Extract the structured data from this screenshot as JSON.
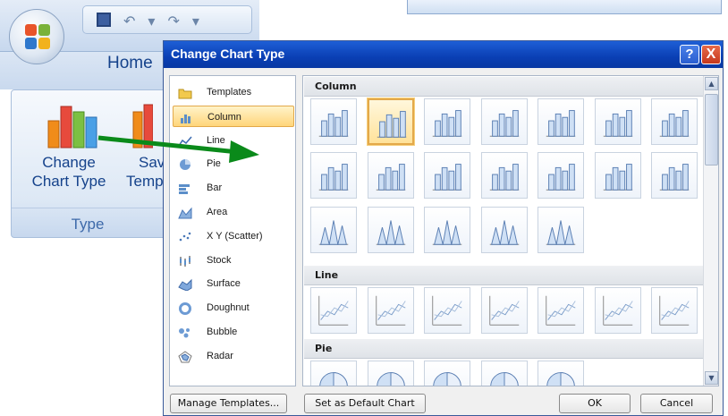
{
  "ribbon": {
    "tab_home": "Home",
    "change_chart_type_line1": "Change",
    "change_chart_type_line2": "Chart Type",
    "save_template_line1": "Save",
    "save_template_line2": "Temp",
    "group_label": "Type"
  },
  "dialog": {
    "title": "Change Chart Type",
    "help_label": "?",
    "close_label": "X",
    "categories": [
      {
        "label": "Templates",
        "icon": "folder-icon"
      },
      {
        "label": "Column",
        "icon": "column-chart-icon",
        "selected": true
      },
      {
        "label": "Line",
        "icon": "line-chart-icon"
      },
      {
        "label": "Pie",
        "icon": "pie-chart-icon"
      },
      {
        "label": "Bar",
        "icon": "bar-chart-icon"
      },
      {
        "label": "Area",
        "icon": "area-chart-icon"
      },
      {
        "label": "X Y (Scatter)",
        "icon": "scatter-chart-icon"
      },
      {
        "label": "Stock",
        "icon": "stock-chart-icon"
      },
      {
        "label": "Surface",
        "icon": "surface-chart-icon"
      },
      {
        "label": "Doughnut",
        "icon": "doughnut-chart-icon"
      },
      {
        "label": "Bubble",
        "icon": "bubble-chart-icon"
      },
      {
        "label": "Radar",
        "icon": "radar-chart-icon"
      }
    ],
    "sections": {
      "column": "Column",
      "line": "Line",
      "pie": "Pie"
    },
    "buttons": {
      "manage_templates": "Manage Templates...",
      "set_default": "Set as Default Chart",
      "ok": "OK",
      "cancel": "Cancel"
    }
  },
  "colors": {
    "titlebar": "#0a3fb4",
    "selection": "#ffd57a",
    "arrow": "#0a8a1a"
  }
}
